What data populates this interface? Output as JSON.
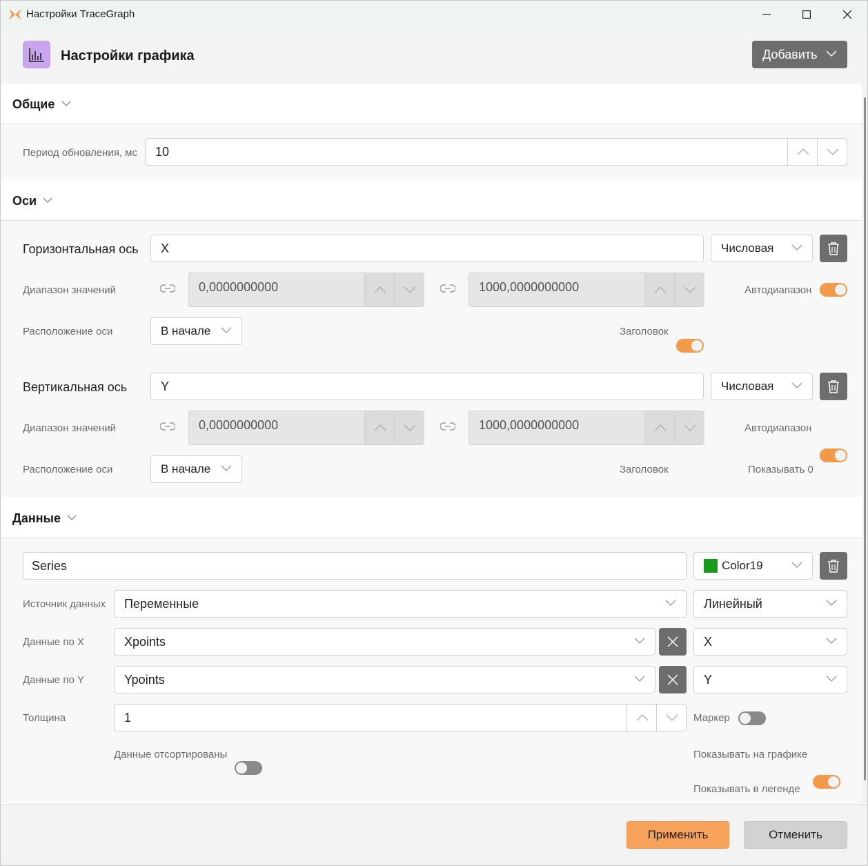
{
  "window": {
    "title": "Настройки TraceGraph",
    "accent": "#f29a4a"
  },
  "header": {
    "title": "Настройки графика",
    "add_label": "Добавить"
  },
  "general": {
    "title": "Общие",
    "period_label": "Период обновления, мс",
    "period_value": "10"
  },
  "axes": {
    "title": "Оси",
    "horizontal": {
      "label": "Горизонтальная ось",
      "name": "X",
      "type": "Числовая",
      "range_label": "Диапазон значений",
      "min": "0,0000000000",
      "max": "1000,0000000000",
      "auto_label": "Автодиапазон",
      "auto": true,
      "position_label": "Расположение оси",
      "position": "В начале",
      "title_label": "Заголовок",
      "title_on": true
    },
    "vertical": {
      "label": "Вертикальная ось",
      "name": "Y",
      "type": "Числовая",
      "range_label": "Диапазон значений",
      "min": "0,0000000000",
      "max": "1000,0000000000",
      "auto_label": "Автодиапазон",
      "auto": true,
      "position_label": "Расположение оси",
      "position": "В начале",
      "title_label": "Заголовок",
      "title_on": true,
      "show_zero_label": "Показывать 0",
      "show_zero": false
    }
  },
  "data": {
    "title": "Данные",
    "series_name": "Series",
    "color_name": "Color19",
    "color_hex": "#1a9a1a",
    "source_label": "Источник данных",
    "source_value": "Переменные",
    "line_type": "Линейный",
    "x_label": "Данные по X",
    "x_value": "Xpoints",
    "x_axis": "X",
    "y_label": "Данные по Y",
    "y_value": "Ypoints",
    "y_axis": "Y",
    "thickness_label": "Толщина",
    "thickness_value": "1",
    "marker_label": "Маркер",
    "marker": false,
    "sorted_label": "Данные отсортированы",
    "sorted": false,
    "show_on_chart_label": "Показывать на графике",
    "show_on_chart": true,
    "show_in_legend_label": "Показывать в легенде",
    "show_in_legend": true
  },
  "footer": {
    "apply_label": "Применить",
    "cancel_label": "Отменить"
  }
}
